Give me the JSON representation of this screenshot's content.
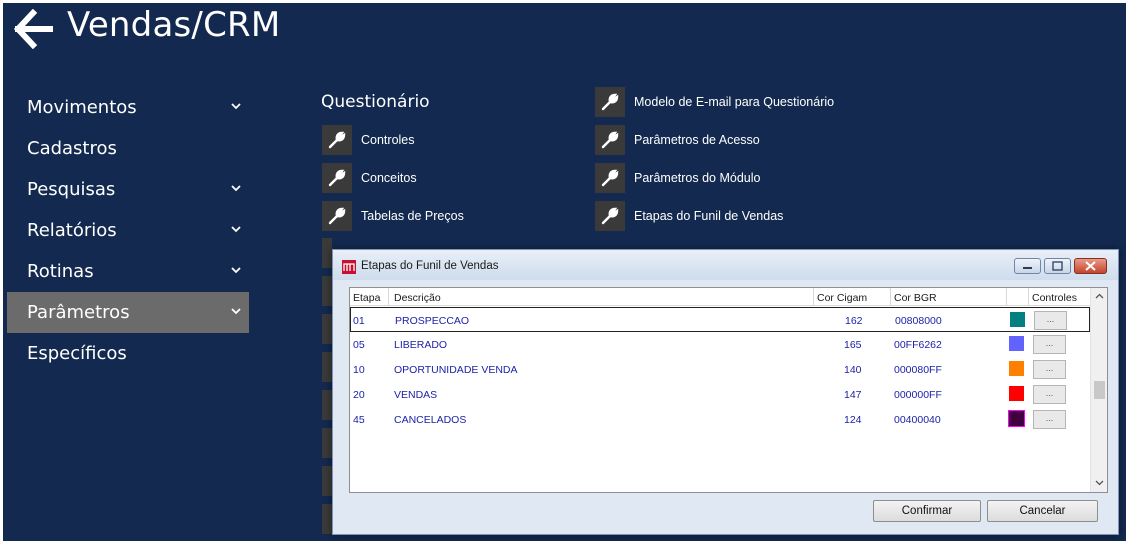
{
  "header": {
    "title": "Vendas/CRM",
    "back_icon": "arrow-left-icon"
  },
  "sidebar": {
    "items": [
      {
        "label": "Movimentos",
        "has_chevron": true,
        "active": false
      },
      {
        "label": "Cadastros",
        "has_chevron": false,
        "active": false
      },
      {
        "label": "Pesquisas",
        "has_chevron": true,
        "active": false
      },
      {
        "label": "Relatórios",
        "has_chevron": true,
        "active": false
      },
      {
        "label": "Rotinas",
        "has_chevron": true,
        "active": false
      },
      {
        "label": "Parâmetros",
        "has_chevron": true,
        "active": true
      },
      {
        "label": "Específicos",
        "has_chevron": false,
        "active": false
      }
    ]
  },
  "main": {
    "section_title": "Questionário",
    "tools_left": [
      {
        "label": "Controles",
        "icon": "wrench-icon"
      },
      {
        "label": "Conceitos",
        "icon": "wrench-icon"
      },
      {
        "label": "Tabelas de Preços",
        "icon": "wrench-icon"
      }
    ],
    "tools_right": [
      {
        "label": "Modelo de E-mail para Questionário",
        "icon": "wrench-icon"
      },
      {
        "label": "Parâmetros de Acesso",
        "icon": "wrench-icon"
      },
      {
        "label": "Parâmetros do Módulo",
        "icon": "wrench-icon"
      },
      {
        "label": "Etapas do Funil de Vendas",
        "icon": "wrench-icon"
      }
    ]
  },
  "dialog": {
    "title": "Etapas do Funil de Vendas",
    "columns": [
      "Etapa",
      "Descrição",
      "Cor Cigam",
      "Cor BGR",
      "Controles"
    ],
    "rows": [
      {
        "etapa": "01",
        "descricao": "PROSPECCAO",
        "cor_cigam": "162",
        "cor_bgr": "00808000",
        "color": "#008080",
        "controls": "...",
        "selected": true
      },
      {
        "etapa": "05",
        "descricao": "LIBERADO",
        "cor_cigam": "165",
        "cor_bgr": "00FF6262",
        "color": "#6262FF",
        "controls": "...",
        "selected": false
      },
      {
        "etapa": "10",
        "descricao": "OPORTUNIDADE VENDA",
        "cor_cigam": "140",
        "cor_bgr": "000080FF",
        "color": "#FF8000",
        "controls": "...",
        "selected": false
      },
      {
        "etapa": "20",
        "descricao": "VENDAS",
        "cor_cigam": "147",
        "cor_bgr": "000000FF",
        "color": "#FF0000",
        "controls": "...",
        "selected": false
      },
      {
        "etapa": "45",
        "descricao": "CANCELADOS",
        "cor_cigam": "124",
        "cor_bgr": "00400040",
        "color": "#400040",
        "controls": "...",
        "selected": false
      }
    ],
    "confirm_label": "Confirmar",
    "cancel_label": "Cancelar"
  },
  "colors": {
    "background": "#13294f",
    "active_item": "#6b6b6b",
    "grid_text": "#1d22a8"
  }
}
